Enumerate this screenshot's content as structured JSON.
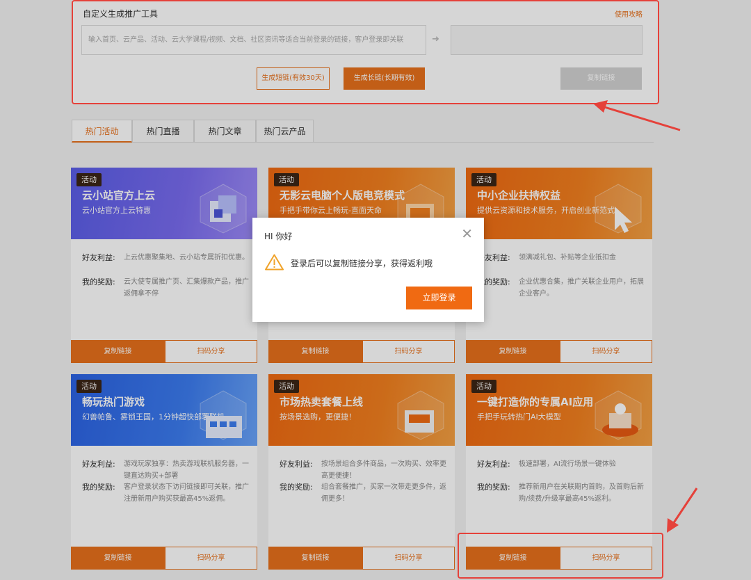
{
  "tool": {
    "title": "自定义生成推广工具",
    "guide_link": "使用攻略",
    "input_placeholder": "输入首页、云产品、活动、云大学课程/视频、文档、社区资讯等适合当前登录的链接，客户登录即关联",
    "arrow_icon": "arrow-right-icon",
    "btn_short": "生成短链(有效30天)",
    "btn_long": "生成长链(长期有效)",
    "btn_copy": "复制链接"
  },
  "tabs": [
    {
      "label": "热门活动",
      "active": true
    },
    {
      "label": "热门直播",
      "active": false
    },
    {
      "label": "热门文章",
      "active": false
    },
    {
      "label": "热门云产品",
      "active": false
    }
  ],
  "labels": {
    "friend_benefit": "好友利益:",
    "my_reward": "我的奖励:",
    "copy_link": "复制链接",
    "scan_share": "扫码分享"
  },
  "cards": [
    {
      "badge": "活动",
      "title": "云小站官方上云",
      "subtitle": "云小站官方上云特惠",
      "friend": "上云优惠聚集地、云小站专属折扣优惠。",
      "reward": "云大使专属推广页、汇集爆款产品，推广返佣拿不停",
      "theme": "purple"
    },
    {
      "badge": "活动",
      "title": "无影云电脑个人版电竞模式",
      "subtitle": "手把手带你云上畅玩-直面天命",
      "friend": "",
      "reward": "",
      "theme": "orange"
    },
    {
      "badge": "活动",
      "title": "中小企业扶持权益",
      "subtitle": "提供云资源和技术服务，开启创业新范式",
      "friend": "领满减礼包、补贴等企业抵扣金",
      "reward": "企业优惠合集，推广关联企业用户，拓展企业客户。",
      "theme": "orange"
    },
    {
      "badge": "活动",
      "title": "畅玩热门游戏",
      "subtitle": "幻兽帕鲁、雾锁王国，1分钟超快部署联机...",
      "friend": "游戏玩家独享：热卖游戏联机服务器，一键直达购买+部署",
      "reward": "客户登录状态下访问链接即可关联，推广注册新用户购买获最高45%返佣。",
      "theme": "blue"
    },
    {
      "badge": "活动",
      "title": "市场热卖套餐上线",
      "subtitle": "按场景选购，更便捷！",
      "friend": "按场景组合多件商品，一次购买、效率更高更便捷！",
      "reward": "组合套餐推广，买家一次带走更多件，返佣更多！",
      "theme": "orange"
    },
    {
      "badge": "活动",
      "title": "一键打造你的专属AI应用",
      "subtitle": "手把手玩转热门AI大模型",
      "friend": "极速部署，AI流行场景一键体验",
      "reward": "推荐新用户在关联期内首购，及首购后新购/续费/升级享最高45%返利。",
      "theme": "orange"
    }
  ],
  "modal": {
    "title": "HI 你好",
    "close_icon": "close-icon",
    "warning_icon": "warning-icon",
    "message": "登录后可以复制链接分享，获得返利哦",
    "button": "立即登录"
  },
  "colors": {
    "accent": "#e8711c",
    "annotation_red": "#e5413a"
  }
}
